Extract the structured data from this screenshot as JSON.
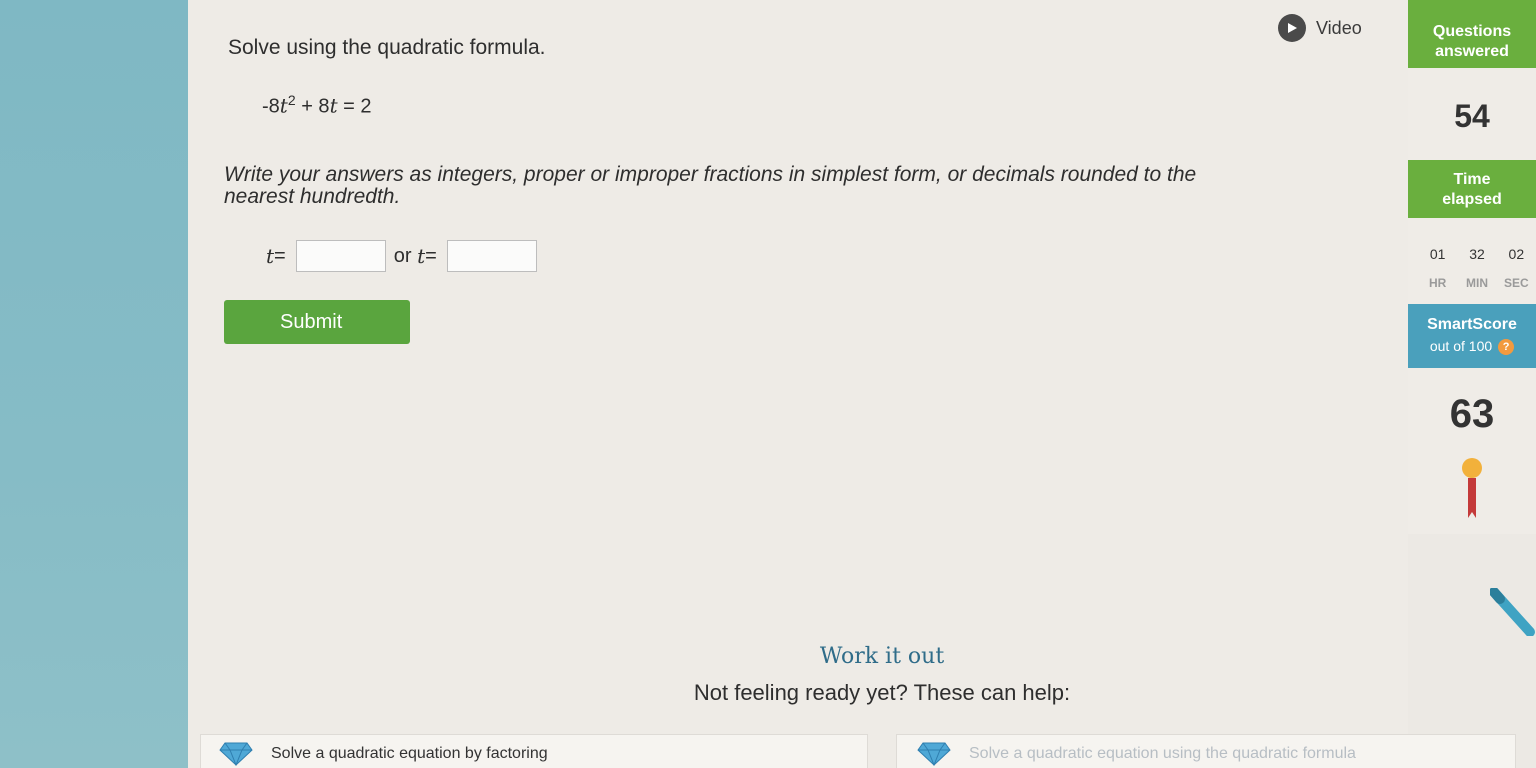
{
  "header": {
    "video_label": "Video"
  },
  "question": {
    "prompt": "Solve using the quadratic formula.",
    "equation": {
      "coef_a": "-8",
      "var": "t",
      "exp": "2",
      "middle": " + 8",
      "equals": " = 2"
    },
    "instructions": "Write your answers as integers, proper or improper fractions in simplest form, or decimals rounded to the nearest hundredth.",
    "answer": {
      "var": "t",
      "eq": " =",
      "or_label": "or",
      "first_value": "",
      "second_value": ""
    },
    "submit_label": "Submit"
  },
  "stats": {
    "questions_label_1": "Questions",
    "questions_label_2": "answered",
    "questions_value": "54",
    "time_label_1": "Time",
    "time_label_2": "elapsed",
    "time": {
      "hr": "01",
      "min": "32",
      "sec": "02"
    },
    "time_units": {
      "hr": "HR",
      "min": "MIN",
      "sec": "SEC"
    },
    "smartscore_label": "SmartScore",
    "smartscore_sub": "out of 100",
    "smartscore_help": "?",
    "smartscore_value": "63"
  },
  "help": {
    "title": "Work it out",
    "subtitle": "Not feeling ready yet? These can help:",
    "cards": [
      {
        "label": "Solve a quadratic equation by factoring"
      },
      {
        "label": "Solve a quadratic equation using the quadratic formula"
      }
    ]
  },
  "colors": {
    "green": "#6aaf3e",
    "blue": "#4aa0bc",
    "submit": "#5aa53e",
    "orange": "#f29a3f"
  },
  "icons": [
    "play-icon",
    "help-icon",
    "medal-icon",
    "pencil-icon",
    "gem-icon"
  ]
}
